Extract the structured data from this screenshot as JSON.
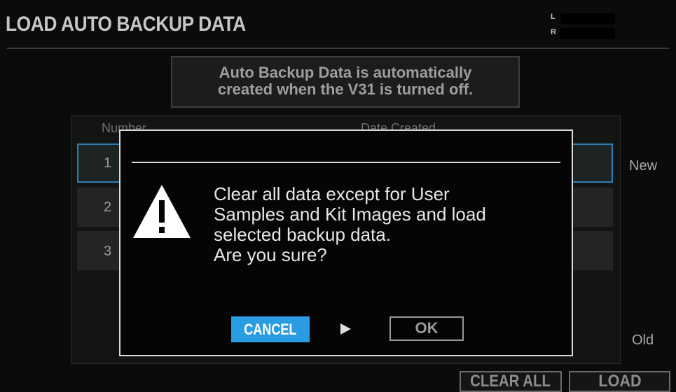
{
  "header": {
    "title": "LOAD AUTO BACKUP DATA",
    "meter_left_label": "L",
    "meter_right_label": "R"
  },
  "info": {
    "line1": "Auto Backup Data is automatically",
    "line2": "created when the V31 is turned off."
  },
  "list": {
    "col_number": "Number",
    "col_date": "Date Created",
    "rows": [
      {
        "number": "1"
      },
      {
        "number": "2"
      },
      {
        "number": "3"
      }
    ],
    "label_new": "New",
    "label_old": "Old"
  },
  "buttons": {
    "clear_all": "CLEAR ALL",
    "load": "LOAD"
  },
  "dialog": {
    "icon": "warning-icon",
    "message_lines": [
      "Clear all data except for User",
      "Samples and Kit Images and load",
      "selected backup data.",
      "Are you sure?"
    ],
    "cancel_label": "CANCEL",
    "ok_label": "OK",
    "arrow_icon": "right-triangle-icon",
    "selected_button": "CANCEL"
  },
  "colors": {
    "accent": "#2a9ce2",
    "selection_border": "#2b7fb6",
    "background": "#0a0b0b"
  }
}
